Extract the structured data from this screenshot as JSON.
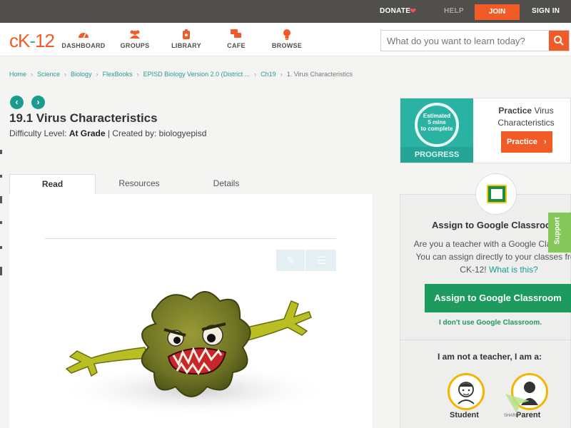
{
  "topbar": {
    "donate": "DONATE",
    "help": "HELP",
    "join": "JOIN",
    "signin": "SIGN IN"
  },
  "header": {
    "logo_left": "cK",
    "logo_right": "12",
    "nav": [
      {
        "label": "DASHBOARD",
        "icon": "dashboard-icon"
      },
      {
        "label": "GROUPS",
        "icon": "groups-icon"
      },
      {
        "label": "LIBRARY",
        "icon": "library-icon"
      },
      {
        "label": "CAFE",
        "icon": "cafe-icon"
      },
      {
        "label": "BROWSE",
        "icon": "browse-icon"
      }
    ],
    "search_placeholder": "What do you want to learn today?"
  },
  "breadcrumb": [
    "Home",
    "Science",
    "Biology",
    "FlexBooks",
    "EPISD Biology Version 2.0 (District ...",
    "Ch19",
    "1. Virus Characteristics"
  ],
  "lesson": {
    "title": "19.1 Virus Characteristics",
    "difficulty_prefix": "Difficulty Level: ",
    "difficulty": "At Grade",
    "created_by": " | Created by: biologyepisd"
  },
  "tabs": [
    "Read",
    "Resources",
    "Details"
  ],
  "practice": {
    "estimated": "Estimated",
    "mins": "5 mins",
    "to_complete": "to complete",
    "progress": "PROGRESS",
    "title_bold": "Practice",
    "title_rest": " Virus Characteristics",
    "button": "Practice"
  },
  "assign": {
    "heading": "Assign to Google Classroom",
    "text": "Are you a teacher with a Google Classroom? You can assign directly to your classes from CK-12!",
    "link": "What is this?",
    "button": "Assign to Google Classroom",
    "no_use": "I don't use Google Classroom.",
    "not_teacher": "I am not a teacher, I am a:",
    "student": "Student",
    "parent": "Parent"
  },
  "support": "Support",
  "share": "SHARE",
  "colors": {
    "brand": "#f15b28",
    "teal": "#1b9c8f",
    "green": "#1d9b5e",
    "topbar": "#514f4c"
  }
}
